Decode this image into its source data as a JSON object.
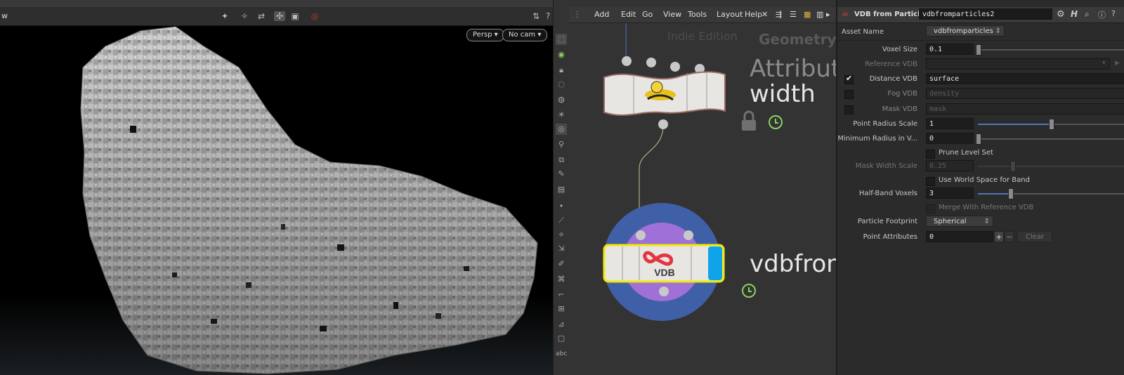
{
  "viewport": {
    "title": "w",
    "camera_persp": "Persp",
    "camera_nocam": "No cam",
    "toolbar_icons": [
      "select-icon",
      "pose-icon",
      "handle-icon",
      "snap-icon",
      "display-icon",
      "record-icon"
    ]
  },
  "network": {
    "menu": [
      "Add",
      "Edit",
      "Go",
      "View",
      "Tools",
      "Layout",
      "Help"
    ],
    "watermark": "Indie Edition",
    "context_label": "Geometry",
    "node1": {
      "type_label": "Attribute",
      "name": "width"
    },
    "node2": {
      "name": "vdbfrom",
      "icon_text": "VDB"
    }
  },
  "params": {
    "node_type": "VDB from Particles",
    "node_name": "vdbfromparticles2",
    "asset_name_label": "Asset Name",
    "asset_name_value": "vdbfromparticles",
    "voxel_size": {
      "label": "Voxel Size",
      "value": "0.1"
    },
    "reference_vdb": {
      "label": "Reference VDB",
      "value": ""
    },
    "distance_vdb": {
      "label": "Distance VDB",
      "value": "surface",
      "checked": true
    },
    "fog_vdb": {
      "label": "Fog VDB",
      "value": "density",
      "checked": false
    },
    "mask_vdb": {
      "label": "Mask VDB",
      "value": "mask",
      "checked": false
    },
    "point_radius_scale": {
      "label": "Point Radius Scale",
      "value": "1",
      "slider_fraction": 0.5
    },
    "min_radius": {
      "label": "Minimum Radius in V...",
      "value": "0",
      "slider_fraction": 0.0
    },
    "prune_level_set": {
      "label": "Prune Level Set",
      "checked": false
    },
    "mask_width_scale": {
      "label": "Mask Width Scale",
      "value": "0.25"
    },
    "use_world_space": {
      "label": "Use World Space for Band",
      "checked": false
    },
    "half_band_voxels": {
      "label": "Half-Band Voxels",
      "value": "3",
      "slider_fraction": 0.22
    },
    "merge_reference": {
      "label": "Merge With Reference VDB",
      "checked": false
    },
    "particle_footprint": {
      "label": "Particle Footprint",
      "value": "Spherical"
    },
    "point_attributes": {
      "label": "Point Attributes",
      "value": "0",
      "plus": "+",
      "minus": "−",
      "clear": "Clear"
    }
  },
  "colors": {
    "accent_blue": "#4f77b8",
    "vdb_red": "#e2373f",
    "node_selected_yellow": "#f2e800",
    "node_ring_blue": "#3f60a6",
    "node_ring_purple": "#9f70d8",
    "clock_green": "#8bd060"
  }
}
